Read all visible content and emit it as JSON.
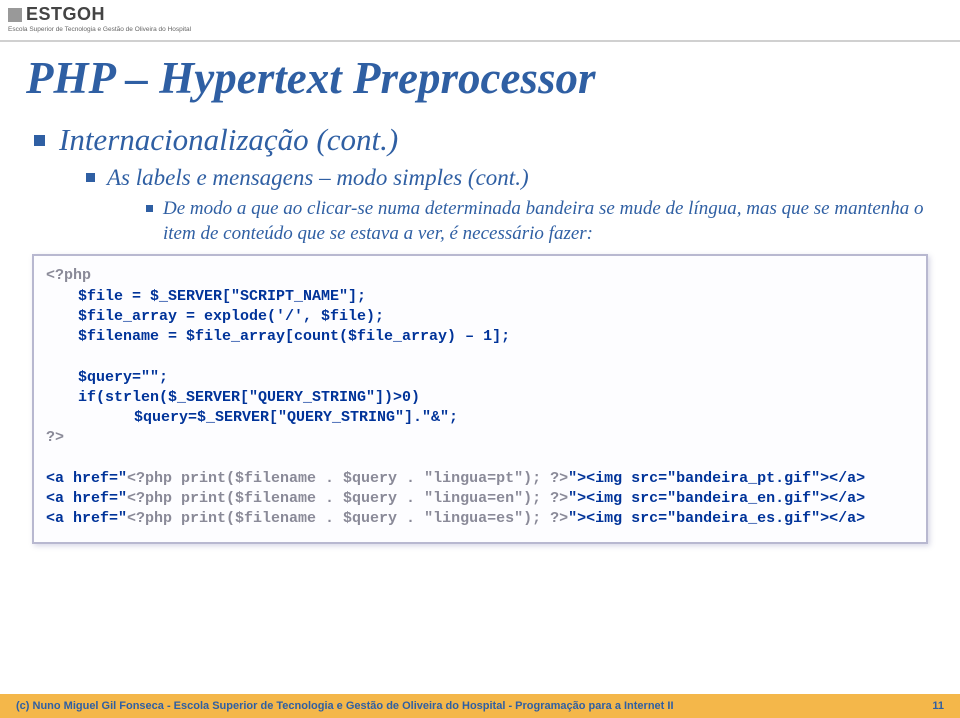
{
  "header": {
    "logo_text": "ESTGOH",
    "logo_sub": "Escola Superior de Tecnologia e Gestão de Oliveira do Hospital"
  },
  "slide": {
    "title": "PHP – Hypertext Preprocessor",
    "bullet1": "Internacionalização (cont.)",
    "bullet2": "As labels e mensagens – modo simples (cont.)",
    "bullet3": "De modo a que ao clicar-se numa determinada bandeira se mude de língua, mas que se mantenha o item de conteúdo que se estava a ver, é necessário fazer:"
  },
  "code": {
    "l1": "<?php",
    "l2": "$file = $_SERVER[\"SCRIPT_NAME\"];",
    "l3": "$file_array = explode('/', $file);",
    "l4": "$filename = $file_array[count($file_array) – 1];",
    "l5": "$query=\"\";",
    "l6": "if(strlen($_SERVER[\"QUERY_STRING\"])>0)",
    "l7": "$query=$_SERVER[\"QUERY_STRING\"].\"&\";",
    "l8": "?>",
    "a1a": "<a href=\"",
    "a1b": "<?php print($filename . $query . \"lingua=pt\"); ?>",
    "a1c": "\"><img src=\"bandeira_pt.gif\"></a>",
    "a2a": "<a href=\"",
    "a2b": "<?php print($filename . $query . \"lingua=en\"); ?>",
    "a2c": "\"><img src=\"bandeira_en.gif\"></a>",
    "a3a": "<a href=\"",
    "a3b": "<?php print($filename . $query . \"lingua=es\"); ?>",
    "a3c": "\"><img src=\"bandeira_es.gif\"></a>"
  },
  "footer": {
    "left": "(c) Nuno Miguel Gil Fonseca  -  Escola Superior de Tecnologia e Gestão de Oliveira do Hospital  -  Programação para a Internet II",
    "page": "11"
  }
}
